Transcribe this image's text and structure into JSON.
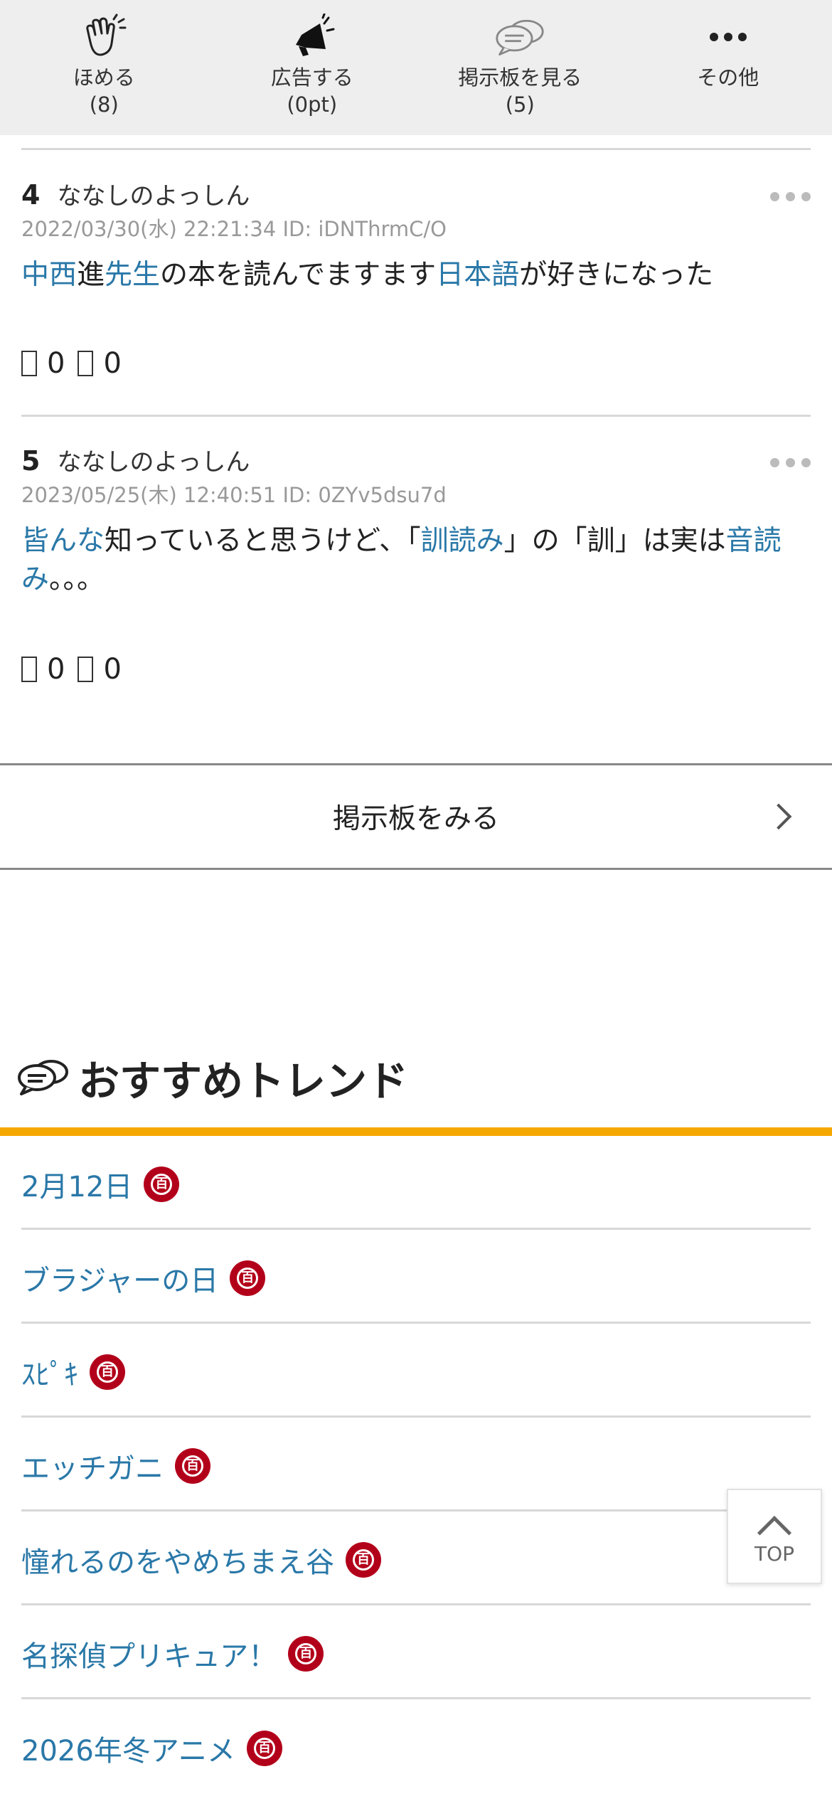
{
  "actions": [
    {
      "label": "ほめる",
      "count": "(8)",
      "icon": "clap-icon"
    },
    {
      "label": "広告する",
      "count": "(0pt)",
      "icon": "megaphone-icon"
    },
    {
      "label": "掲示板を見る",
      "count": "(5)",
      "icon": "chat-bubbles-icon"
    },
    {
      "label": "その他",
      "count": "",
      "icon": "more-dots-icon"
    }
  ],
  "comments": [
    {
      "number": "4",
      "name": "ななしのよっしん",
      "meta": "2022/03/30(水) 22:21:34 ID: iDNThrmC/O",
      "body": [
        {
          "text": "中西",
          "link": true
        },
        {
          "text": "進",
          "link": false
        },
        {
          "text": "先生",
          "link": true
        },
        {
          "text": "の本を読んでますます",
          "link": false
        },
        {
          "text": "日本語",
          "link": true
        },
        {
          "text": "が好きになった",
          "link": false
        }
      ],
      "good": "0",
      "bad": "0"
    },
    {
      "number": "5",
      "name": "ななしのよっしん",
      "meta": "2023/05/25(木) 12:40:51 ID: 0ZYv5dsu7d",
      "body": [
        {
          "text": "皆んな",
          "link": true
        },
        {
          "text": "知っていると思うけど、「",
          "link": false
        },
        {
          "text": "訓読み",
          "link": true
        },
        {
          "text": "」の「訓」は実は",
          "link": false
        },
        {
          "text": "音読み",
          "link": true
        },
        {
          "text": "。。。",
          "link": false
        }
      ],
      "good": "0",
      "bad": "0"
    }
  ],
  "board_link": {
    "label": "掲示板をみる"
  },
  "trends": {
    "title": "おすすめトレンド",
    "badge_text": "百",
    "items": [
      "2月12日",
      "ブラジャーの日",
      "ｽﾋﾟｷ",
      "エッチガニ",
      "憧れるのをやめちまえ谷",
      "名探偵プリキュア！",
      "2026年冬アニメ"
    ]
  },
  "top_button": {
    "label": "TOP"
  },
  "colors": {
    "link": "#2a78a8",
    "accent_bar": "#f5a800",
    "badge": "#b3001a",
    "topbar_bg": "#eeeeee"
  }
}
